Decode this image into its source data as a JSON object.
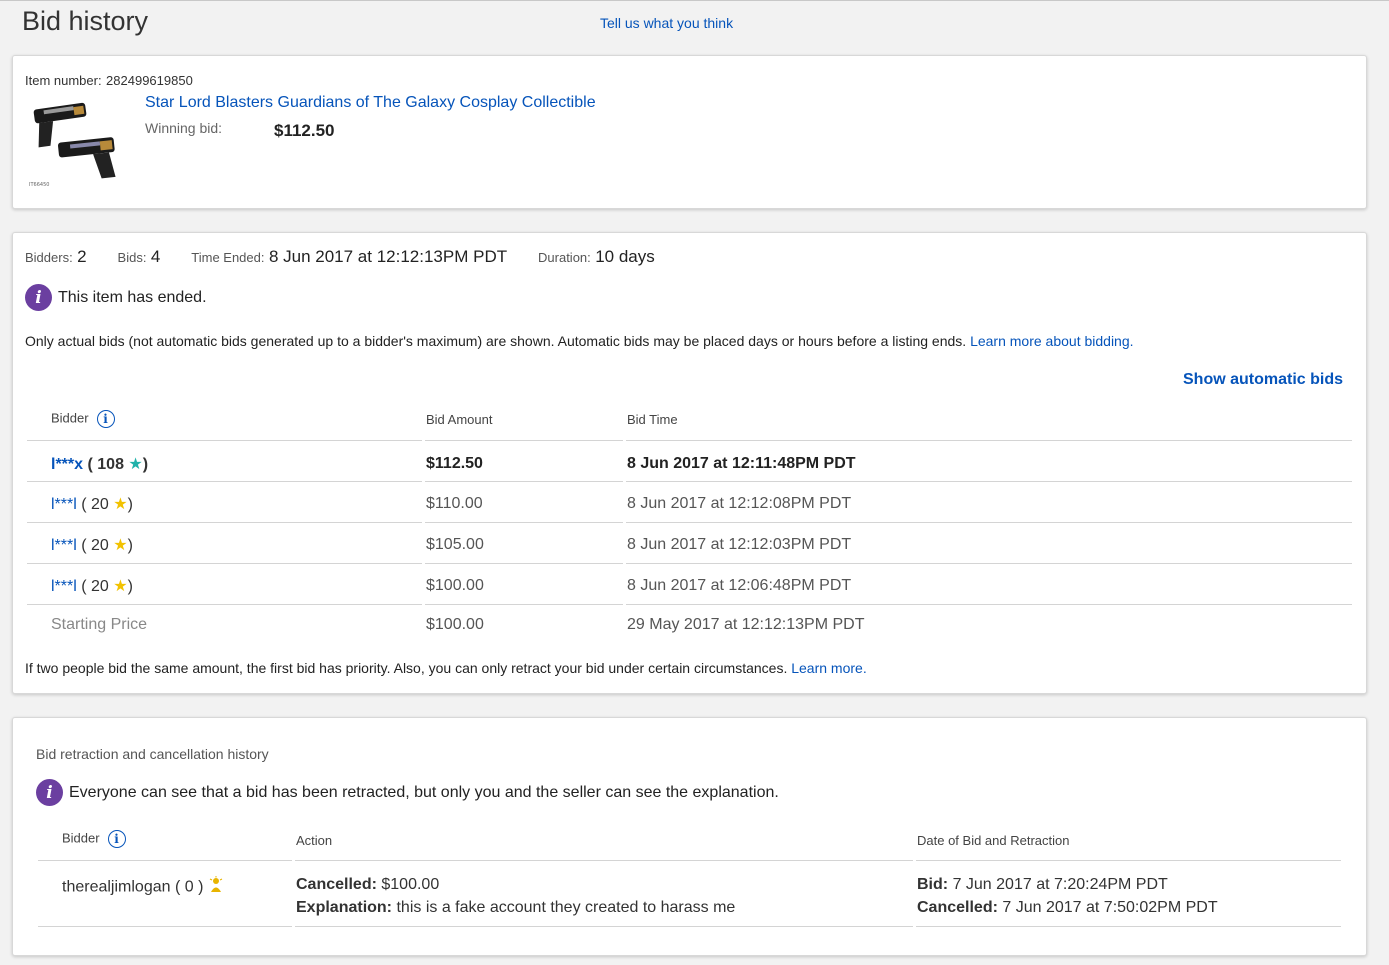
{
  "page": {
    "title": "Bid history",
    "feedback_link": "Tell us what you think"
  },
  "item": {
    "number_label": "Item number:",
    "number": "282499619850",
    "title": "Star Lord Blasters Guardians of The Galaxy Cosplay Collectible",
    "winning_bid_label": "Winning bid:",
    "winning_bid": "$112.50",
    "thumbnail_icon": "toy-blaster-thumbnail"
  },
  "summary": {
    "bidders_label": "Bidders:",
    "bidders": "2",
    "bids_label": "Bids:",
    "bids": "4",
    "time_ended_label": "Time Ended:",
    "time_ended": "8 Jun 2017 at 12:12:13PM PDT",
    "duration_label": "Duration:",
    "duration": "10 days"
  },
  "ended_notice": "This item has ended.",
  "actual_bids_note": "Only actual bids (not automatic bids generated up to a bidder's maximum) are shown. Automatic bids may be placed days or hours before a listing ends.",
  "learn_more_bidding": "Learn more about bidding.",
  "show_automatic_bids": "Show automatic bids",
  "bid_table": {
    "headers": [
      "Bidder",
      "Bid Amount",
      "Bid Time"
    ],
    "rows": [
      {
        "bidder": "l***x",
        "score": "108",
        "open": "(",
        "close": ")",
        "amount": "$112.50",
        "time": "8 Jun 2017 at 12:11:48PM PDT",
        "star": "teal-star-icon"
      },
      {
        "bidder": "l***l",
        "score": "20",
        "open": "(",
        "close": ")",
        "amount": "$110.00",
        "time": "8 Jun 2017 at 12:12:08PM PDT",
        "star": "gold-star-icon"
      },
      {
        "bidder": "l***l",
        "score": "20",
        "open": "(",
        "close": ")",
        "amount": "$105.00",
        "time": "8 Jun 2017 at 12:12:03PM PDT",
        "star": "gold-star-icon"
      },
      {
        "bidder": "l***l",
        "score": "20",
        "open": "(",
        "close": ")",
        "amount": "$100.00",
        "time": "8 Jun 2017 at 12:06:48PM PDT",
        "star": "gold-star-icon"
      }
    ],
    "starting": {
      "label": "Starting Price",
      "amount": "$100.00",
      "time": "29 May 2017 at 12:12:13PM PDT"
    }
  },
  "priority_note": "If two people bid the same amount, the first bid has priority. Also, you can only retract your bid under certain circumstances.",
  "learn_more": "Learn more.",
  "retraction": {
    "title": "Bid retraction and cancellation history",
    "notice": "Everyone can see that a bid has been retracted, but only you and the seller can see the explanation.",
    "headers": [
      "Bidder",
      "Action",
      "Date of Bid and Retraction"
    ],
    "row": {
      "bidder": "therealjimlogan",
      "score": "( 0 )",
      "cancelled_label": "Cancelled:",
      "cancelled_value": "$100.00",
      "explanation_label": "Explanation:",
      "explanation_value": "this is a fake account they created to harass me",
      "bid_label": "Bid:",
      "bid_value": "7 Jun 2017 at 7:20:24PM PDT",
      "cancelled_date_label": "Cancelled:",
      "cancelled_date_value": "7 Jun 2017 at 7:50:02PM PDT"
    }
  },
  "colors": {
    "link": "#0654ba",
    "info_icon": "#6b3fa0",
    "teal_star": "#20b2aa",
    "gold_star": "#f2c200"
  }
}
